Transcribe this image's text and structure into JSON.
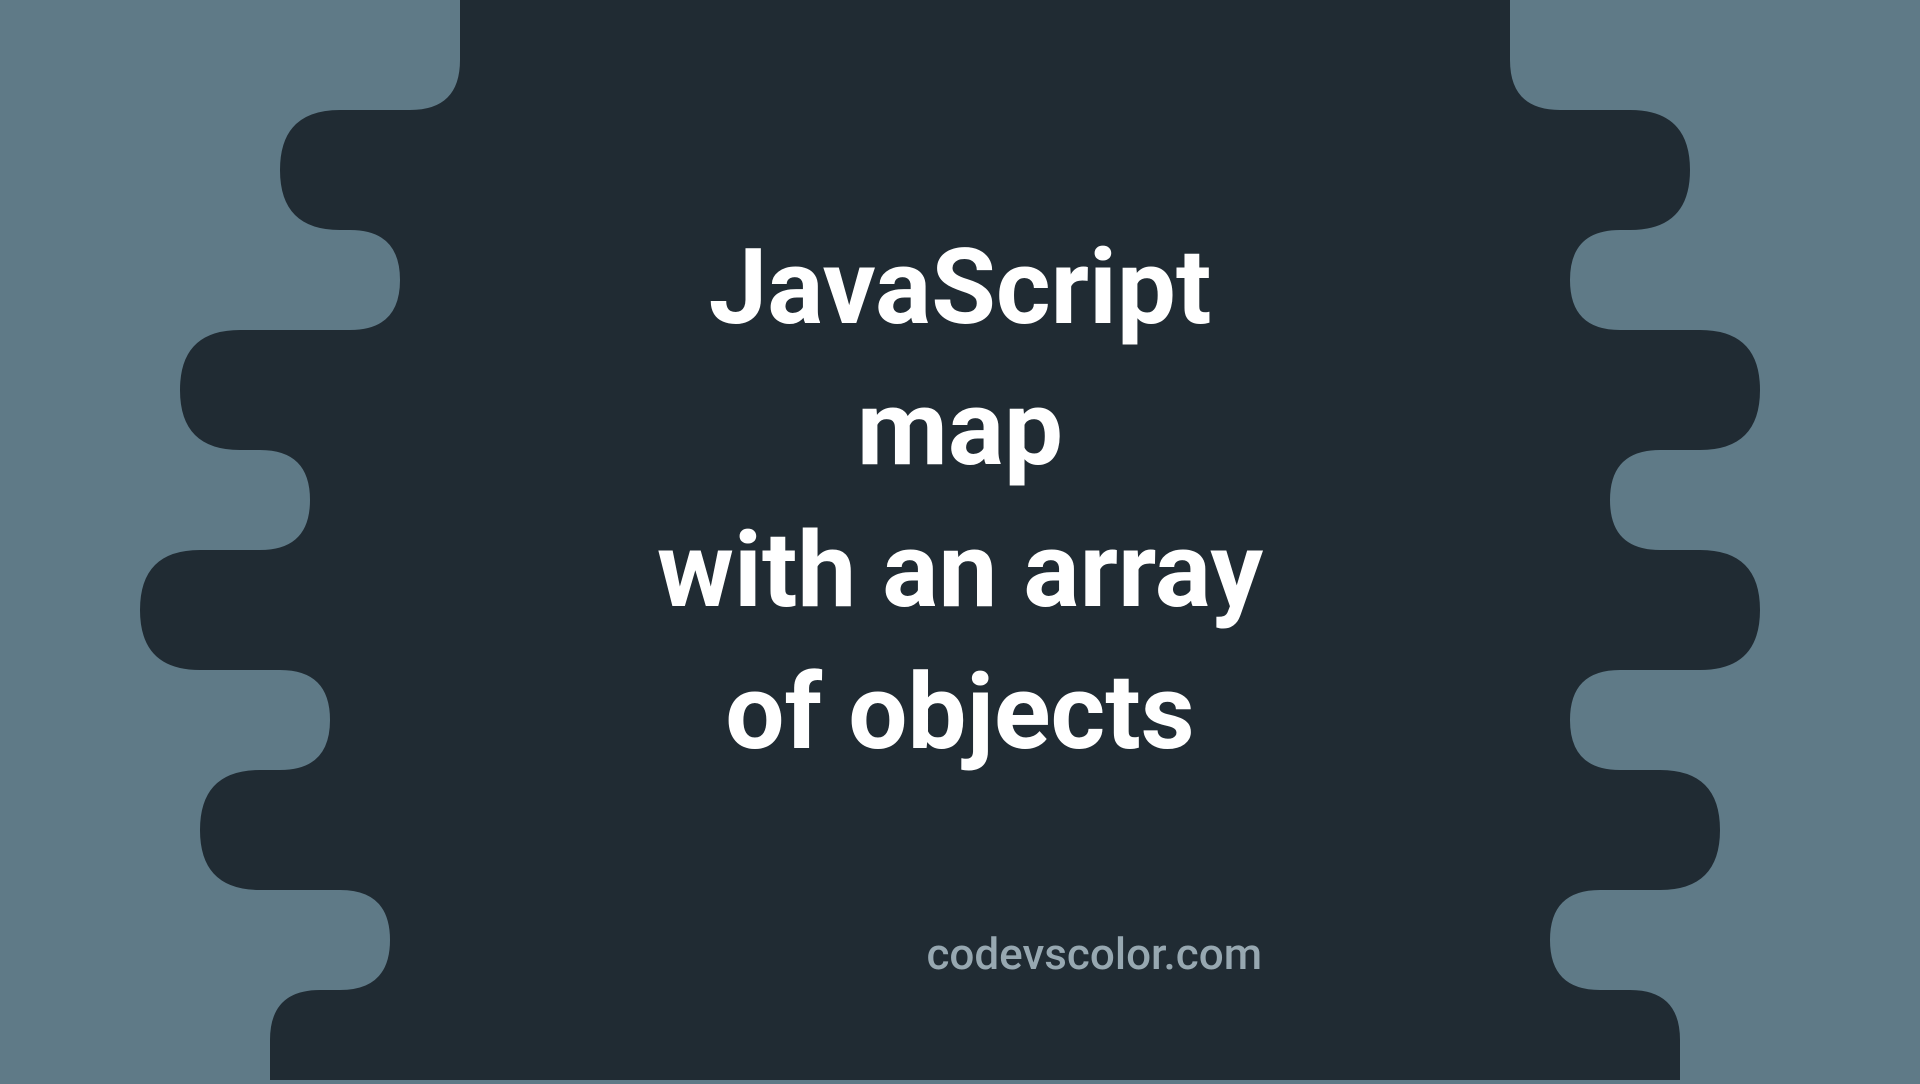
{
  "title": {
    "line1": "JavaScript",
    "line2": "map",
    "line3": "with an array",
    "line4": "of objects"
  },
  "credit": "codevscolor.com",
  "colors": {
    "background": "#5F7A87",
    "blob": "#202B33",
    "titleText": "#FFFFFF",
    "creditText": "#97A8B1"
  }
}
